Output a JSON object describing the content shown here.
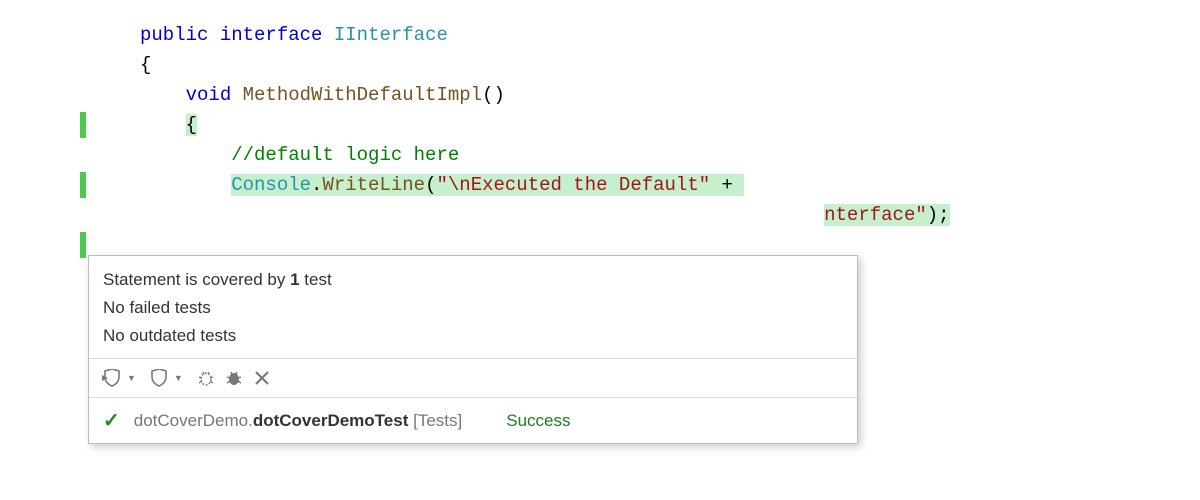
{
  "code": {
    "line1": {
      "kw_public": "public",
      "kw_interface": "interface",
      "type_name": "IInterface"
    },
    "line2": {
      "brace": "{"
    },
    "line3": {
      "kw_void": "void",
      "method_name": "MethodWithDefaultImpl",
      "parens": "()"
    },
    "line4": {
      "brace": "{"
    },
    "line5": {
      "comment": "//default logic here"
    },
    "line6": {
      "console": "Console",
      "dot": ".",
      "writeline": "WriteLine",
      "paren_open": "(",
      "string": "\"\\nExecuted the Default\"",
      "plus": " + "
    },
    "line7": {
      "tail": "nterface\"",
      "close": ");"
    }
  },
  "tooltip": {
    "line1_a": "Statement is covered by ",
    "line1_b": "1",
    "line1_c": " test",
    "line2": "No failed tests",
    "line3": "No outdated tests"
  },
  "result": {
    "ns_prefix": "dotCoverDemo.",
    "ns_bold": "dotCoverDemoTest",
    "suffix": " [Tests]",
    "status": "Success"
  }
}
